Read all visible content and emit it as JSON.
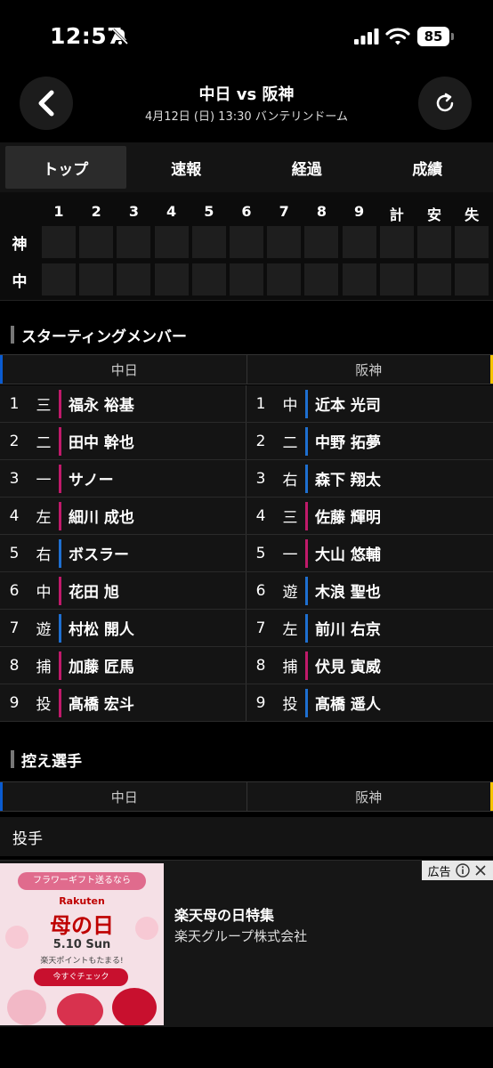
{
  "status": {
    "time": "12:57",
    "battery": "85"
  },
  "header": {
    "title": "中日 vs 阪神",
    "subtitle": "4月12日 (日) 13:30 バンテリンドーム"
  },
  "tabs": [
    "トップ",
    "速報",
    "経過",
    "成績"
  ],
  "scoreboard": {
    "columns": [
      "1",
      "2",
      "3",
      "4",
      "5",
      "6",
      "7",
      "8",
      "9",
      "計",
      "安",
      "失"
    ],
    "teams": [
      "神",
      "中"
    ]
  },
  "starting": {
    "title": "スターティングメンバー",
    "home": "中日",
    "away": "阪神",
    "colors": {
      "home_bar": "#0a5bd0",
      "away_bar": "#f5c400",
      "bar_blue": "#1e6fd0",
      "bar_magenta": "#c01a6a"
    },
    "rows": [
      {
        "num": "1",
        "h_pos": "三",
        "h_name": "福永 裕基",
        "h_bar": "magenta",
        "a_pos": "中",
        "a_name": "近本 光司",
        "a_bar": "blue"
      },
      {
        "num": "2",
        "h_pos": "二",
        "h_name": "田中 幹也",
        "h_bar": "magenta",
        "a_pos": "二",
        "a_name": "中野 拓夢",
        "a_bar": "blue"
      },
      {
        "num": "3",
        "h_pos": "一",
        "h_name": "サノー",
        "h_bar": "magenta",
        "a_pos": "右",
        "a_name": "森下 翔太",
        "a_bar": "blue"
      },
      {
        "num": "4",
        "h_pos": "左",
        "h_name": "細川 成也",
        "h_bar": "magenta",
        "a_pos": "三",
        "a_name": "佐藤 輝明",
        "a_bar": "magenta"
      },
      {
        "num": "5",
        "h_pos": "右",
        "h_name": "ボスラー",
        "h_bar": "blue",
        "a_pos": "一",
        "a_name": "大山 悠輔",
        "a_bar": "magenta"
      },
      {
        "num": "6",
        "h_pos": "中",
        "h_name": "花田 旭",
        "h_bar": "magenta",
        "a_pos": "遊",
        "a_name": "木浪 聖也",
        "a_bar": "blue"
      },
      {
        "num": "7",
        "h_pos": "遊",
        "h_name": "村松 開人",
        "h_bar": "blue",
        "a_pos": "左",
        "a_name": "前川 右京",
        "a_bar": "blue"
      },
      {
        "num": "8",
        "h_pos": "捕",
        "h_name": "加藤 匠馬",
        "h_bar": "magenta",
        "a_pos": "捕",
        "a_name": "伏見 寅威",
        "a_bar": "magenta"
      },
      {
        "num": "9",
        "h_pos": "投",
        "h_name": "髙橋 宏斗",
        "h_bar": "magenta",
        "a_pos": "投",
        "a_name": "髙橋 遥人",
        "a_bar": "blue"
      }
    ]
  },
  "bench": {
    "title": "控え選手",
    "home": "中日",
    "away": "阪神",
    "pitcher_label": "投手"
  },
  "ad": {
    "tag": "広告",
    "banner": "フラワーギフト送るなら",
    "brand": "Rakuten",
    "headline": "母の日",
    "date": "5.10 Sun",
    "points": "楽天ポイントもたまる!",
    "cta": "今すぐチェック",
    "title": "楽天母の日特集",
    "sponsor": "楽天グループ株式会社"
  }
}
